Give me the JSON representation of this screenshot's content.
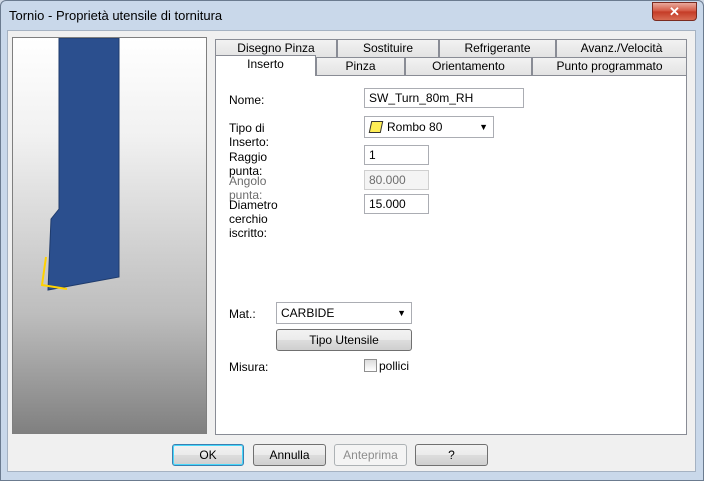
{
  "window": {
    "title": "Tornio - Proprietà utensile di tornitura",
    "close_glyph": "✕"
  },
  "tabs_row1": [
    "Disegno Pinza",
    "Sostituire",
    "Refrigerante",
    "Avanz./Velocità"
  ],
  "tabs_row2": [
    "Inserto",
    "Pinza",
    "Orientamento",
    "Punto programmato"
  ],
  "active_tab": "Inserto",
  "form": {
    "nome_label": "Nome:",
    "nome_value": "SW_Turn_80m_RH",
    "tipo_label": "Tipo di Inserto:",
    "tipo_value": "Rombo 80",
    "raggio_label": "Raggio punta:",
    "raggio_value": "1",
    "angolo_label": "Angolo punta:",
    "angolo_value": "80.000",
    "diametro_label": "Diametro cerchio iscritto:",
    "diametro_value": "15.000",
    "mat_label": "Mat.:",
    "mat_value": "CARBIDE",
    "tipo_utensile_label": "Tipo Utensile",
    "misura_label": "Misura:",
    "pollici_label": "pollici",
    "pollici_checked": false
  },
  "buttons": {
    "ok": "OK",
    "annulla": "Annulla",
    "anteprima": "Anteprima",
    "help": "?"
  },
  "colors": {
    "tool_blue": "#2b4f8e",
    "insert_yellow": "#ffd200",
    "close_red": "#c43a25"
  },
  "icons": {
    "close": "close-icon",
    "dropdown": "chevron-down-icon",
    "insert_shape": "rhombus-icon"
  }
}
